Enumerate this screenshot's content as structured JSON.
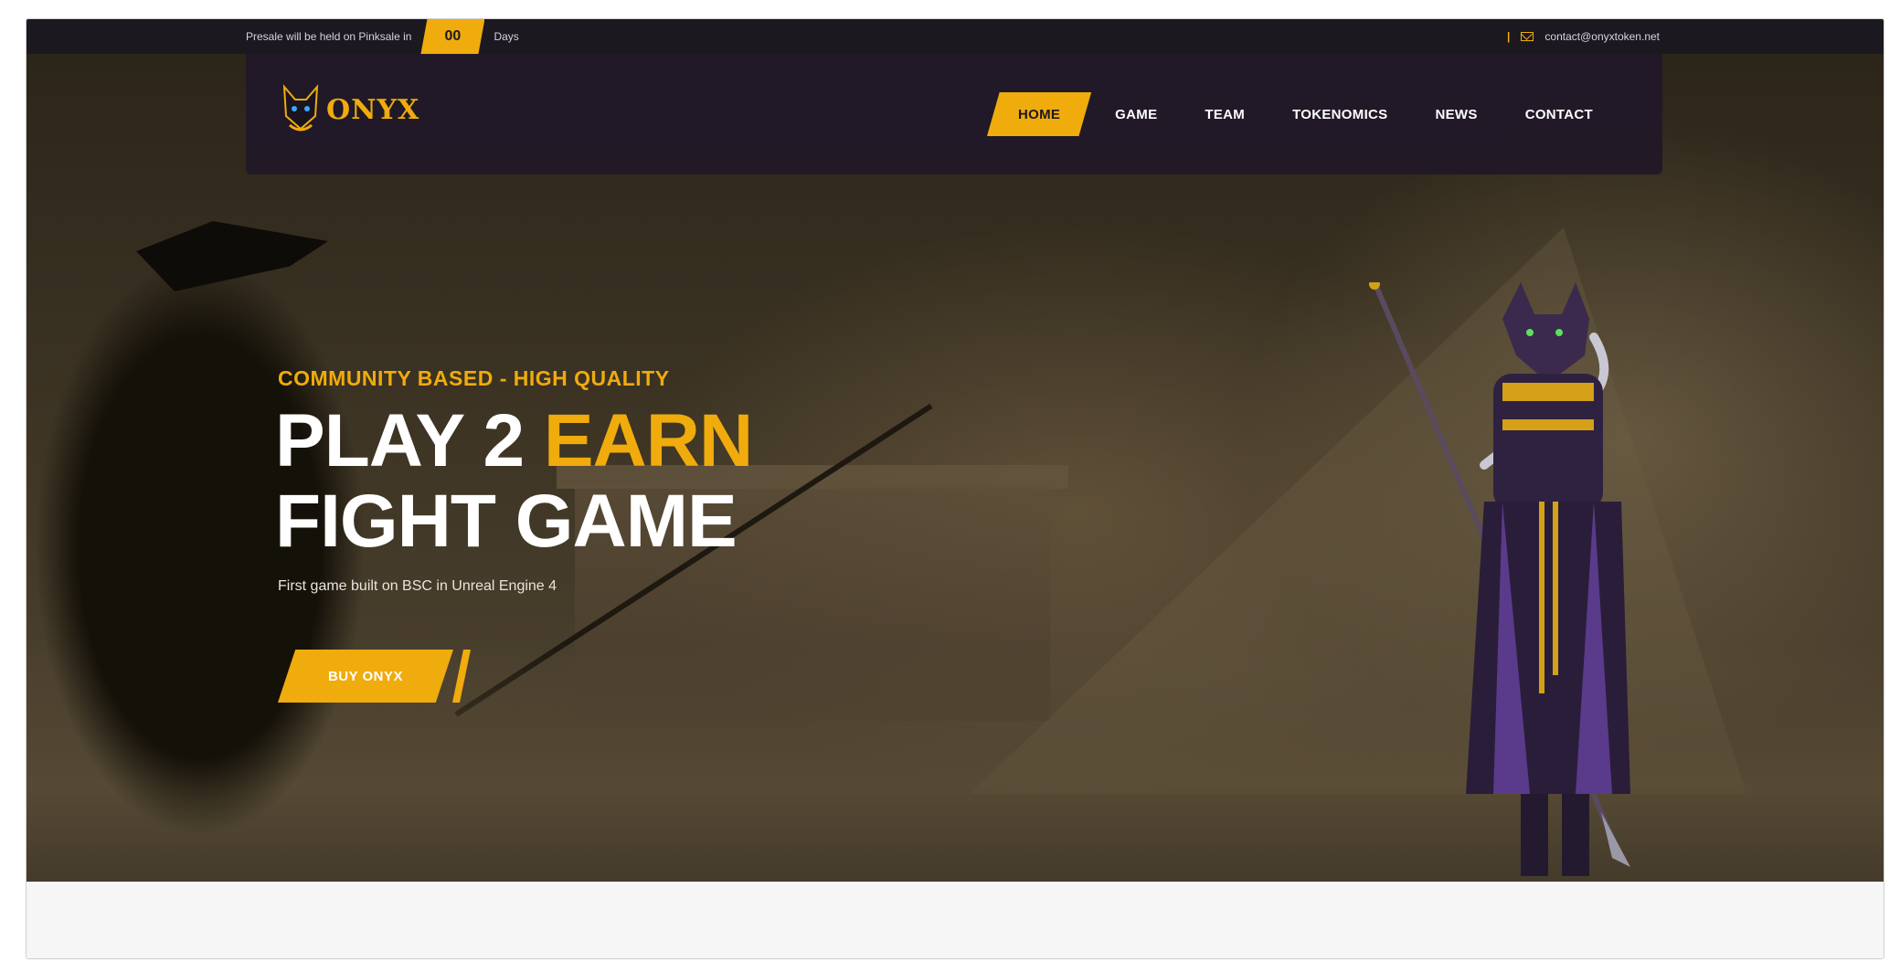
{
  "topbar": {
    "presale_text": "Presale will be held on Pinksale in",
    "counter_value": "00",
    "counter_unit": "Days",
    "separator": "|",
    "email": "contact@onyxtoken.net"
  },
  "logo": {
    "text": "ONYX"
  },
  "nav": {
    "items": [
      {
        "label": "HOME",
        "active": true
      },
      {
        "label": "GAME",
        "active": false
      },
      {
        "label": "TEAM",
        "active": false
      },
      {
        "label": "TOKENOMICS",
        "active": false
      },
      {
        "label": "NEWS",
        "active": false
      },
      {
        "label": "CONTACT",
        "active": false
      }
    ]
  },
  "hero": {
    "tagline": "COMMUNITY BASED - HIGH QUALITY",
    "headline_line1_a": "PLAY 2 ",
    "headline_line1_b": "EARN",
    "headline_line2": "FIGHT GAME",
    "subtitle": "First game built on BSC in Unreal Engine 4",
    "cta_label": "BUY ONYX"
  },
  "colors": {
    "accent": "#f0ab0d",
    "nav_background": "#211828",
    "topbar_background": "#1c1820"
  },
  "icons": [
    "mail-icon",
    "onyx-cat-logo-icon"
  ]
}
